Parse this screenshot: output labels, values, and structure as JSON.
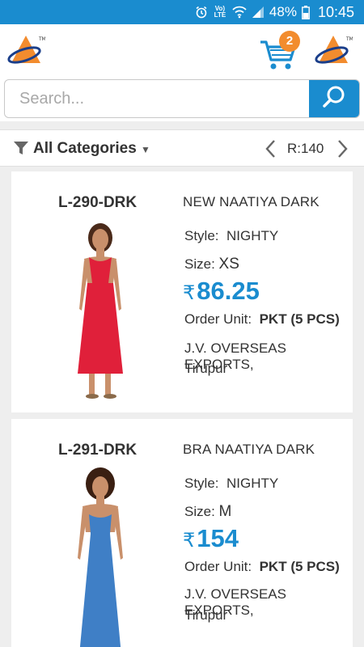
{
  "statusbar": {
    "volte": "Vo) LTE",
    "battery": "48%",
    "time": "10:45"
  },
  "header": {
    "cart_count": "2"
  },
  "search": {
    "placeholder": "Search..."
  },
  "filter": {
    "label": "All Categories",
    "range_label": "R:140"
  },
  "products": [
    {
      "code": "L-290-DRK",
      "name": "NEW NAATIYA DARK",
      "style_label": "Style:",
      "style_value": "NIGHTY",
      "size_label": "Size:",
      "size_value": "XS",
      "currency": "₹",
      "price": "86.25",
      "order_unit_label": "Order Unit:",
      "order_unit_value": "PKT (5 PCS)",
      "seller": "J.V. OVERSEAS EXPORTS,",
      "city": "Tirupur",
      "dress_color": "#e0203a"
    },
    {
      "code": "L-291-DRK",
      "name": "BRA NAATIYA DARK",
      "style_label": "Style:",
      "style_value": "NIGHTY",
      "size_label": "Size:",
      "size_value": "M",
      "currency": "₹",
      "price": "154",
      "order_unit_label": "Order Unit:",
      "order_unit_value": "PKT (5 PCS)",
      "seller": "J.V. OVERSEAS EXPORTS,",
      "city": "Tirupur",
      "dress_color": "#3f7fc6"
    }
  ],
  "colors": {
    "brand_blue": "#1a8ccf",
    "badge_orange": "#f28c2e"
  },
  "icons": [
    "alarm-icon",
    "wifi-icon",
    "signal-icon",
    "battery-icon",
    "logo-icon",
    "cart-icon",
    "search-icon",
    "filter-icon",
    "chevron-down-icon",
    "chevron-left-icon",
    "chevron-right-icon"
  ]
}
